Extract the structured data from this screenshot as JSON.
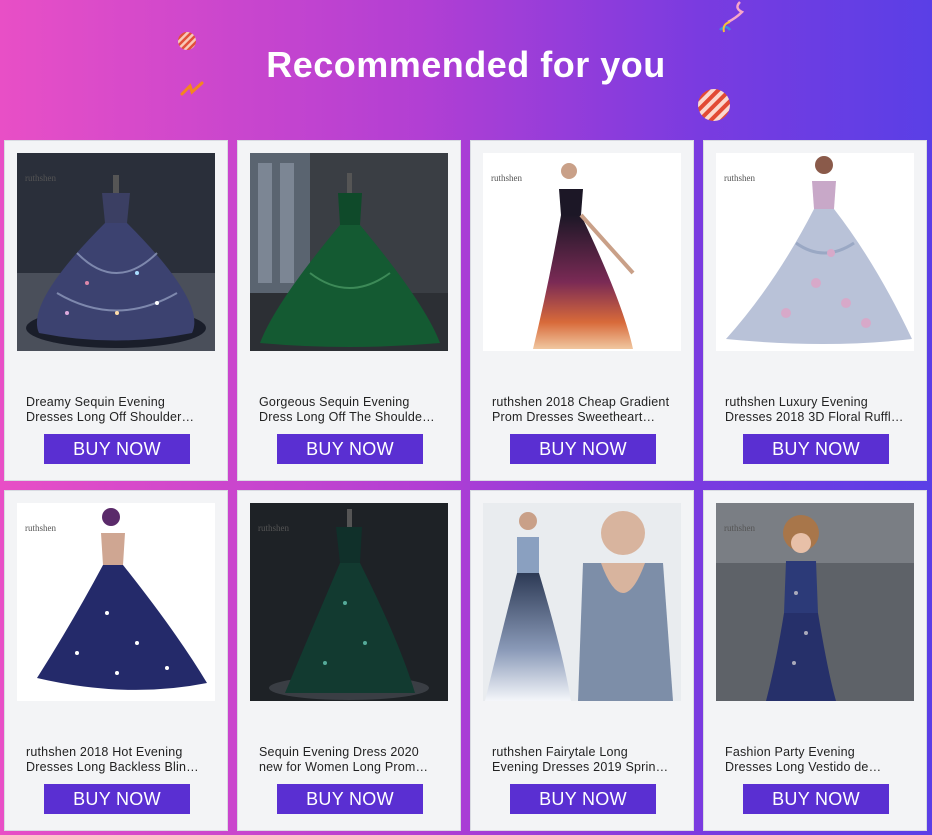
{
  "header": {
    "title": "Recommended for you"
  },
  "colors": {
    "button": "#5a2fd2",
    "card_bg": "#f3f4f6"
  },
  "products": [
    {
      "line1": "Dreamy Sequin Evening",
      "line2": "Dresses Long Off Shoulder…",
      "button": "BUY NOW",
      "watermark": "ruthshen",
      "icon": "sequin-ballgown-navy"
    },
    {
      "line1": "Gorgeous Sequin Evening",
      "line2": "Dress Long Off The Shoulde…",
      "button": "BUY NOW",
      "watermark": "",
      "icon": "sequin-ballgown-green"
    },
    {
      "line1": "ruthshen 2018 Cheap Gradient",
      "line2": "Prom Dresses Sweetheart…",
      "button": "BUY NOW",
      "watermark": "ruthshen",
      "icon": "gradient-gown"
    },
    {
      "line1": "ruthshen Luxury Evening",
      "line2": "Dresses 2018 3D Floral Ruffl…",
      "button": "BUY NOW",
      "watermark": "ruthshen",
      "icon": "floral-ballgown"
    },
    {
      "line1": "ruthshen 2018 Hot Evening",
      "line2": "Dresses Long Backless Blin…",
      "button": "BUY NOW",
      "watermark": "ruthshen",
      "icon": "starry-backless-gown"
    },
    {
      "line1": "Sequin Evening Dress 2020",
      "line2": "new for Women Long Prom…",
      "button": "BUY NOW",
      "watermark": "ruthshen",
      "icon": "sequin-aline-green"
    },
    {
      "line1": "ruthshen Fairytale Long",
      "line2": "Evening Dresses 2019 Sprin…",
      "button": "BUY NOW",
      "watermark": "",
      "icon": "fairytale-gown"
    },
    {
      "line1": "Fashion Party Evening",
      "line2": "Dresses Long Vestido de…",
      "button": "BUY NOW",
      "watermark": "ruthshen",
      "icon": "sequin-mermaid"
    }
  ]
}
